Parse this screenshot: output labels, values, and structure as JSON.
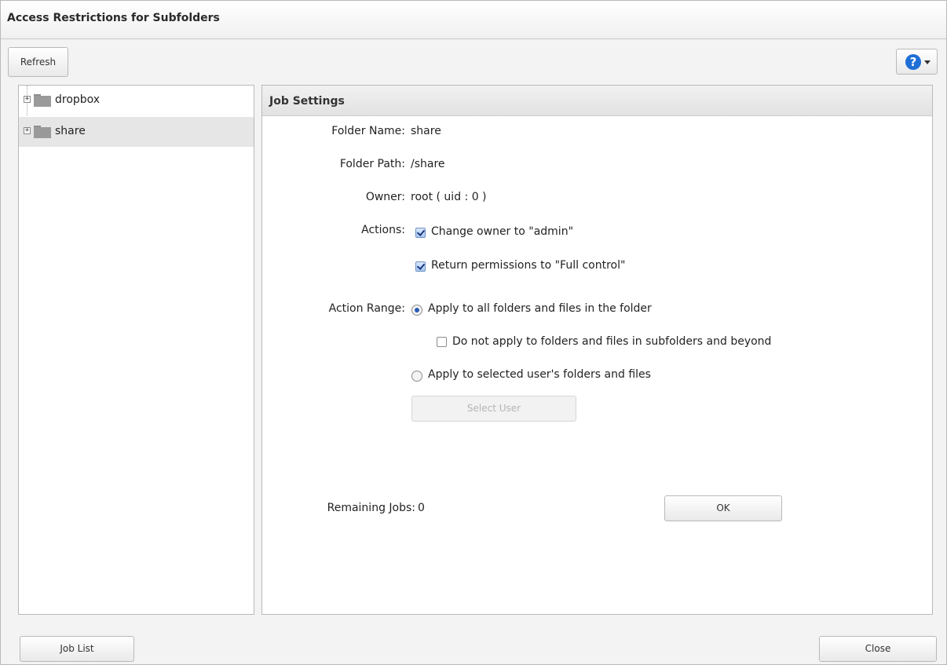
{
  "window": {
    "title": "Access Restrictions for Subfolders"
  },
  "toolbar": {
    "refresh_label": "Refresh",
    "help_icon": "help-icon",
    "help_glyph": "?"
  },
  "tree": {
    "items": [
      {
        "label": "dropbox",
        "expander": "+",
        "icon": "folder-icon",
        "selected": false
      },
      {
        "label": "share",
        "expander": "+",
        "icon": "folder-icon",
        "selected": true
      }
    ]
  },
  "job_settings": {
    "title": "Job Settings",
    "folder_name_label": "Folder Name:",
    "folder_name_value": "share",
    "folder_path_label": "Folder Path:",
    "folder_path_value": "/share",
    "owner_label": "Owner:",
    "owner_value": "root ( uid : 0 )",
    "actions_label": "Actions:",
    "actions": [
      {
        "label": "Change owner to \"admin\"",
        "checked": true
      },
      {
        "label": "Return permissions to \"Full control\"",
        "checked": true
      }
    ],
    "action_range_label": "Action Range:",
    "range_options": [
      {
        "label": "Apply to all folders and files in the folder",
        "selected": true
      },
      {
        "label": "Apply to selected user's folders and files",
        "selected": false
      }
    ],
    "subfolder_option": {
      "label": "Do not apply to folders and files in subfolders and beyond",
      "checked": false
    },
    "select_user_label": "Select User",
    "remaining_jobs_label": "Remaining Jobs:",
    "remaining_jobs_value": "0",
    "ok_label": "OK"
  },
  "footer": {
    "job_list_label": "Job List",
    "close_label": "Close"
  },
  "colors": {
    "accent": "#1f6fd6",
    "selected_row": "#e6e6e6",
    "panel_border": "#b9b9b9"
  }
}
